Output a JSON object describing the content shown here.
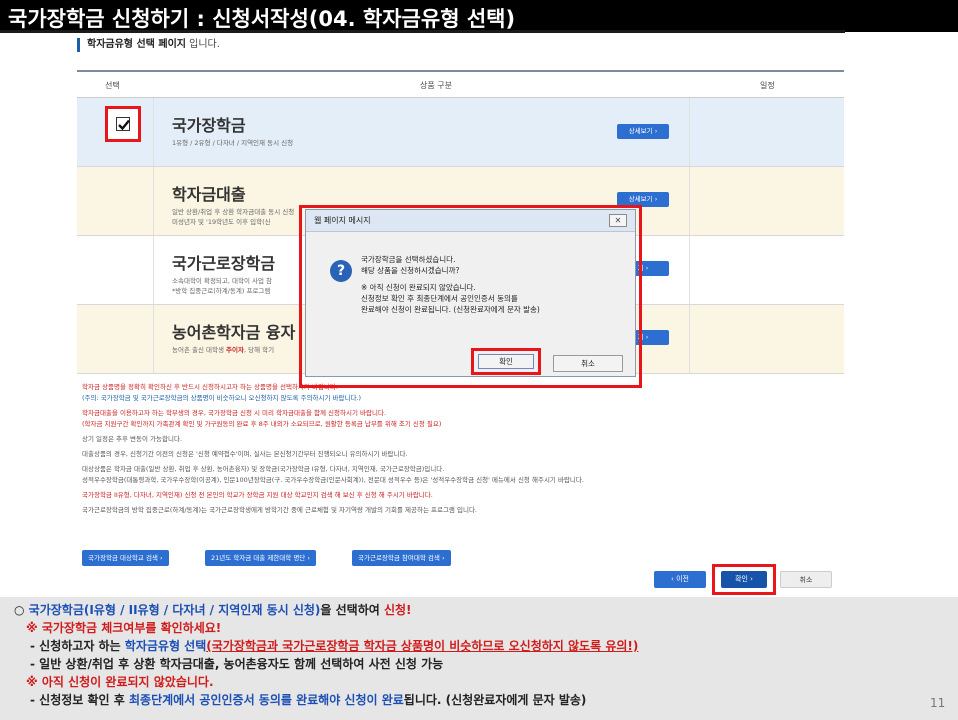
{
  "page_title": "국가장학금 신청하기 : 신청서작성(04. 학자금유형 선택)",
  "sub_heading_bold": "학자금유형 선택 페이지",
  "sub_heading_rest": " 입니다.",
  "table_headers": {
    "select": "선택",
    "product": "상품 구분",
    "schedule": "일정"
  },
  "rows": [
    {
      "name": "국가장학금",
      "desc1": "1유형 / 2유형 / 다자녀 / 지역인재 동시 신청",
      "desc2": "",
      "detail": "상세보기 ›"
    },
    {
      "name": "학자금대출",
      "desc1": "일반 상환/취업 후 상환 학자금대출 동시 신청",
      "desc2": "미성년자 및 '19학년도 이후 입학(신",
      "detail": "상세보기 ›"
    },
    {
      "name": "국가근로장학금",
      "desc1": "소속대학이 확정되고, 대학이 사업 참",
      "desc2": "*방학 집중근로(하계/동계) 프로그램",
      "detail": "기 ›"
    },
    {
      "name": "농어촌학자금 융자",
      "desc1_a": "농어촌 출신 대학생 ",
      "desc1_b": "주이자",
      "desc1_c": ", 당해 학기",
      "detail": "기 ›"
    }
  ],
  "notes": [
    "학자금 상품명을 정확히 확인하신 후 반드시 신청하시고자 하는 상품명을 선택하시기 바랍니다.",
    "(주의: 국가장학금 및 국가근로장학금의 상품명이 비슷하오니 오신청하지 않도록 주의하시기 바랍니다.)",
    "학자금대출을 이용하고자 하는 학부생의 경우, 국가장학금 신청 시 미리 학자금대출을 함께 신청하시기 바랍니다.",
    "(학자금 지원구간 확인까지 가족관계 확인 및 가구원동의 완료 후 8주 내외가 소요되므로, 원활한 등록금 납부를 위해 조기 신청 필요)",
    "상기 일정은 추후 변동이 가능합니다.",
    "대출상품의 경우, 신청기간 이전의 신청은 '신청 예약접수'이며, 실사는 본신청기간부터 진행되오니 유의하시기 바랍니다.",
    "대상상품은 학자금 대출(일반 상환, 취업 후 상환, 농어촌융자) 및 장학금(국가장학금 I유형, 다자녀, 지역인재, 국가근로장학금)입니다.",
    "성적우수장학금(대통령과학, 국가우수장학(이공계), 인문100년장학금(구. 국가우수장학금(인문사회계)), 전문대 성적우수 등)은 '성적우수장학금 신청' 메뉴에서 신청 해주시기 바랍니다.",
    "국가장학금 II유형, 다자녀, 지역인재) 신청 전 본인의 학교가 장학금 지원 대상 학교인지 검색 해 보신 후 신청 해 주시기 바랍니다.",
    "국가근로장학금의 방학 집중근로(하계/동계)는 국가근로장학생에게 방학기간 중에 근로체험 및 자기역량 개발의 기회를 제공하는 프로그램 입니다."
  ],
  "link_buttons": [
    "국가장학금 대상학교 검색 ›",
    "21년도 학자금 대출 제한대학 명단 ›",
    "국가근로장학금 참여대학 검색 ›"
  ],
  "nav": {
    "prev": "‹ 이전",
    "ok": "확인 ›",
    "cancel": "취소"
  },
  "dialog": {
    "title": "웹 페이지 메시지",
    "close": "✕",
    "line1": "국가장학금을 선택하셨습니다.",
    "line2": "해당 상품을 신청하시겠습니까?",
    "line3": "※ 아직 신청이 완료되지 않았습니다.",
    "line4": "신청정보 확인 후 최종단계에서 공인인증서 동의를",
    "line5": "완료해야 신청이 완료됩니다. (신청완료자에게 문자 발송)",
    "ok": "확인",
    "cancel": "취소"
  },
  "bottom": {
    "l1_a": "○ ",
    "l1_b": "국가장학금(I유형 / II유형 / 다자녀 / 지역인재 동시 신청)",
    "l1_c": "을 선택하여 ",
    "l1_d": "신청!",
    "l2": "※ 국가장학금 체크여부를 확인하세요!",
    "l3_a": "- 신청하고자 하는 ",
    "l3_b": "학자금유형 선택",
    "l3_c": "(국가장학금과 국가근로장학금 학자금 상품명이 비슷하므로 오신청하지 않도록 유의!)",
    "l4": "- 일반 상환/취업 후 상환 학자금대출, 농어촌융자도 함께 선택하여 사전 신청 가능",
    "l5": "※ 아직 신청이 완료되지 않았습니다.",
    "l6_a": "- 신청정보 확인 후 ",
    "l6_b": "최종단계에서 공인인증서 동의를 완료해야 신청이 완료",
    "l6_c": "됩니다. (신청완료자에게 문자 발송)"
  },
  "page_number": "11",
  "colors": {
    "accent_blue": "#2c6fd1",
    "highlight_red": "#e8161a"
  }
}
